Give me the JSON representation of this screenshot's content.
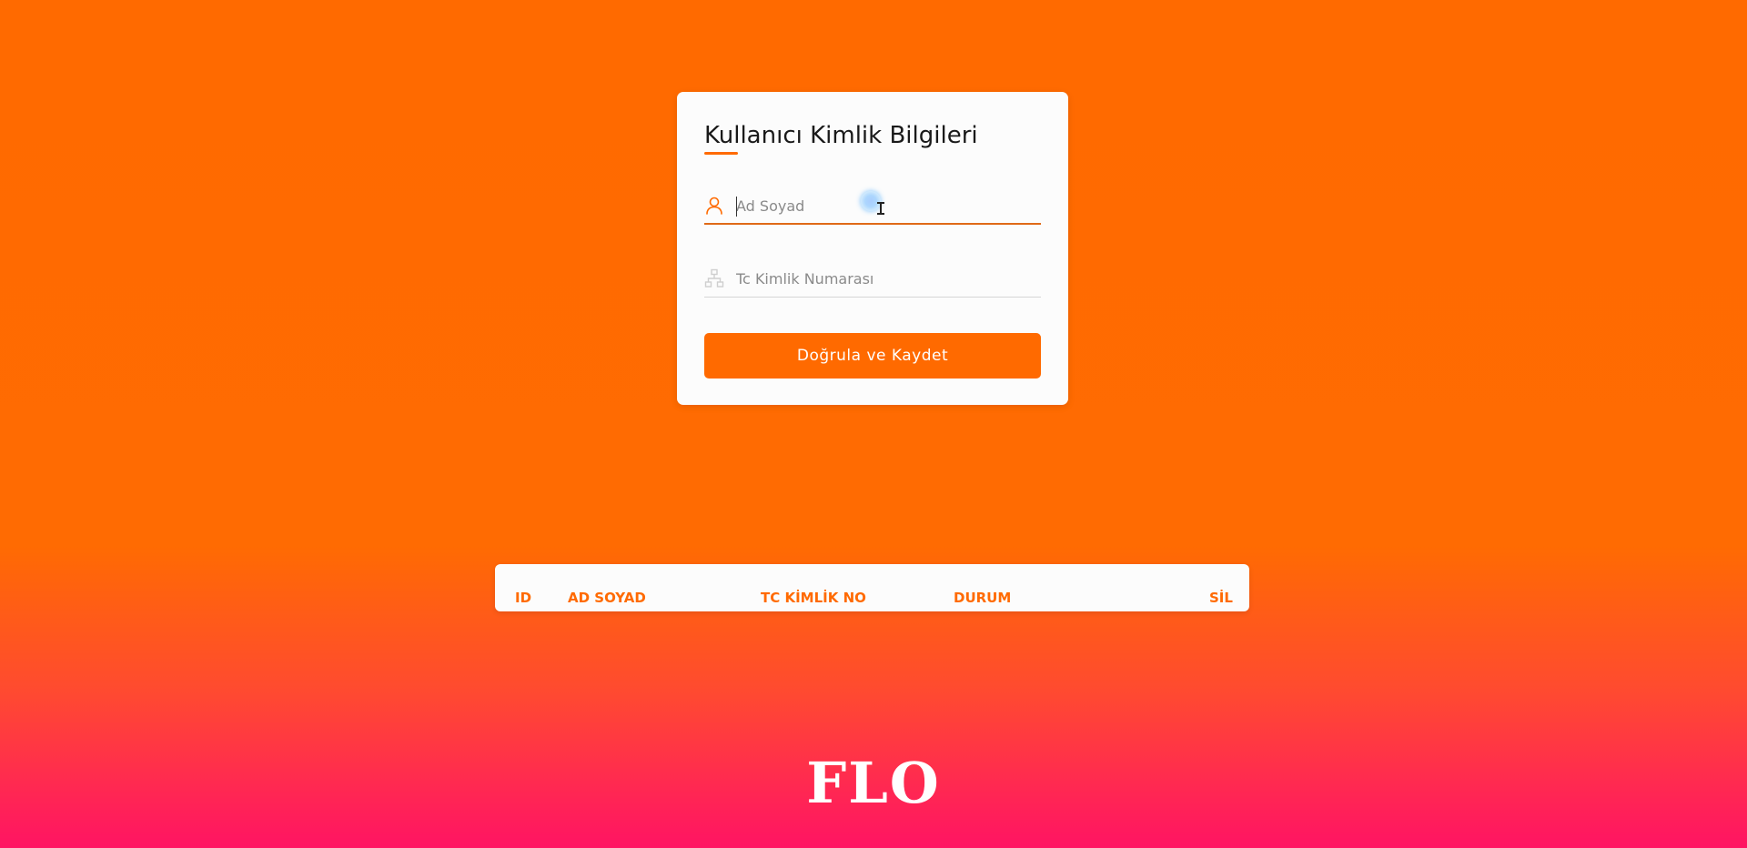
{
  "form": {
    "title": "Kullanıcı Kimlik Bilgileri",
    "name_placeholder": "Ad Soyad",
    "name_value": "",
    "tc_placeholder": "Tc Kimlik Numarası",
    "tc_value": "",
    "submit_label": "Doğrula ve Kaydet",
    "icons": {
      "name": "user-icon",
      "tc": "sitemap-icon"
    }
  },
  "table": {
    "columns": [
      "ID",
      "AD SOYAD",
      "TC KİMLİK NO",
      "DURUM",
      "SİL"
    ],
    "rows": []
  },
  "brand": {
    "logo_text": "FLO"
  },
  "colors": {
    "accent": "#ff6a00",
    "background_top": "#ff6a00",
    "background_bottom": "#ff1463",
    "card": "#fcfcfc"
  }
}
